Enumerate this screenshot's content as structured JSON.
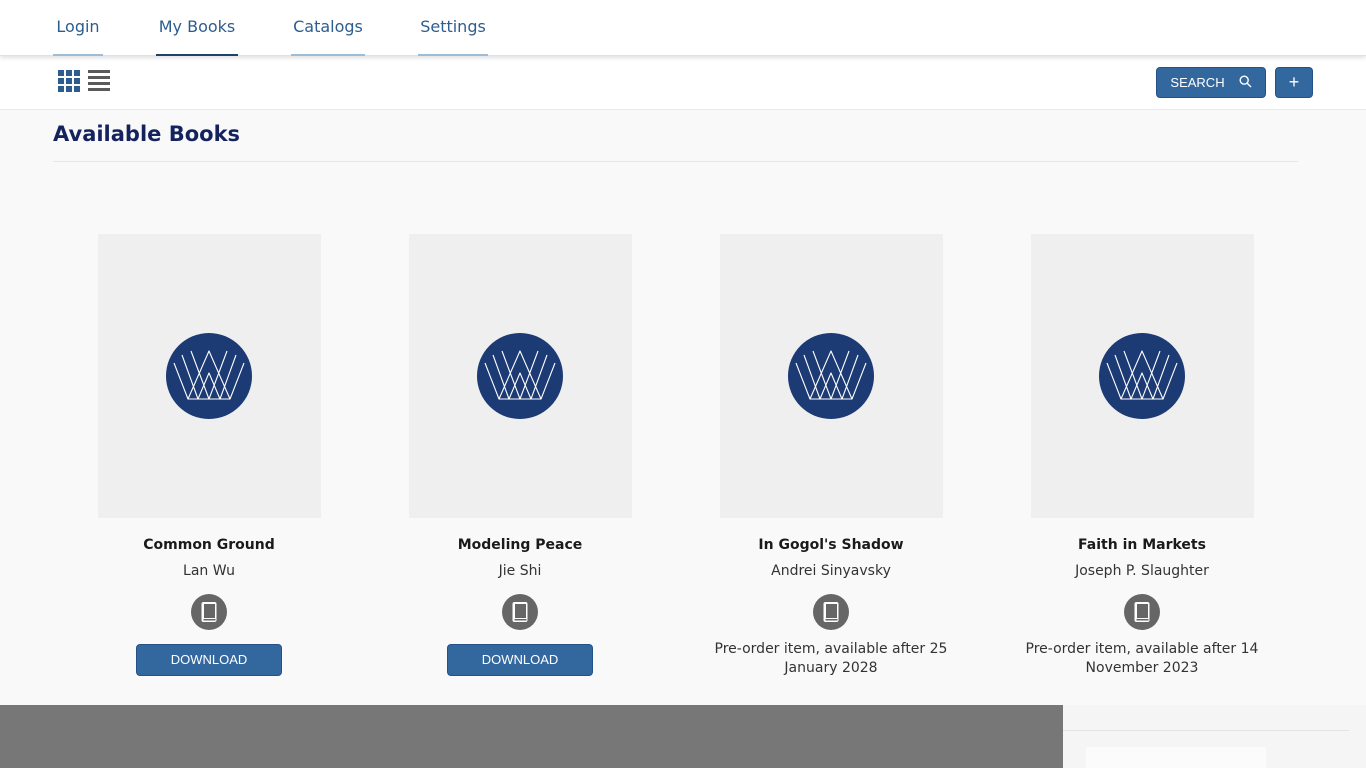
{
  "nav": {
    "tabs": [
      {
        "label": "Login",
        "active": false
      },
      {
        "label": "My Books",
        "active": true
      },
      {
        "label": "Catalogs",
        "active": false
      },
      {
        "label": "Settings",
        "active": false
      }
    ]
  },
  "toolbar": {
    "grid_view_icon": "grid-view-icon",
    "list_view_icon": "list-view-icon",
    "search_label": "SEARCH",
    "search_icon": "search-icon",
    "add_label": "+"
  },
  "main": {
    "title": "Available Books",
    "books": [
      {
        "title": "Common Ground",
        "author": "Lan Wu",
        "action": "DOWNLOAD"
      },
      {
        "title": "Modeling Peace",
        "author": "Jie Shi",
        "action": "DOWNLOAD"
      },
      {
        "title": "In Gogol's Shadow",
        "author": "Andrei Sinyavsky",
        "status": "Pre-order item, available after 25 January 2028"
      },
      {
        "title": "Faith in Markets",
        "author": "Joseph P. Slaughter",
        "status": "Pre-order item, available after 14 November 2023"
      }
    ]
  },
  "colors": {
    "accent": "#33689f",
    "heading": "#14235e",
    "logo_circle": "#1c3a74",
    "cover_bg": "#efefef",
    "format_icon": "#666666"
  }
}
